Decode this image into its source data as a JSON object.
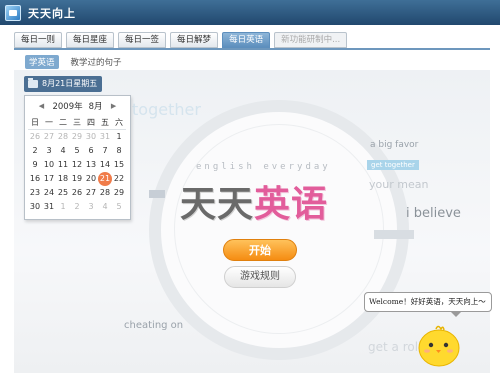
{
  "app": {
    "title": "天天向上",
    "icon": "app-window-icon"
  },
  "tabs": [
    {
      "label": "每日一则",
      "active": false
    },
    {
      "label": "每日星座",
      "active": false
    },
    {
      "label": "每日一签",
      "active": false
    },
    {
      "label": "每日解梦",
      "active": false
    },
    {
      "label": "每日英语",
      "active": true
    },
    {
      "label": "新功能研制中...",
      "active": false,
      "disabled": true
    }
  ],
  "subtabs": [
    {
      "label": "学英语",
      "active": true
    },
    {
      "label": "教学过的句子",
      "active": false
    }
  ],
  "date_chip": {
    "label": "8月21日星期五",
    "icon": "folder-icon"
  },
  "calendar": {
    "year": "2009年",
    "month": "8月",
    "prev": "◀",
    "next": "▶",
    "weekdays": [
      "日",
      "一",
      "二",
      "三",
      "四",
      "五",
      "六"
    ],
    "days": [
      [
        "26",
        "27",
        "28",
        "29",
        "30",
        "31",
        "1"
      ],
      [
        "2",
        "3",
        "4",
        "5",
        "6",
        "7",
        "8"
      ],
      [
        "9",
        "10",
        "11",
        "12",
        "13",
        "14",
        "15"
      ],
      [
        "16",
        "17",
        "18",
        "19",
        "20",
        "21",
        "22"
      ],
      [
        "23",
        "24",
        "25",
        "26",
        "27",
        "28",
        "29"
      ],
      [
        "30",
        "31",
        "1",
        "2",
        "3",
        "4",
        "5"
      ]
    ]
  },
  "logo": {
    "tagline": "english everyday",
    "part1": "天天",
    "part2": "英语",
    "colors": {
      "gray": "#6a6a6a",
      "pink": "#e25d9b"
    }
  },
  "buttons": {
    "start": "开始",
    "rules": "游戏规则"
  },
  "background_words": {
    "big_favor": "a big favor",
    "get_together_tag": "get together",
    "your_mean": "your mean",
    "i_believe": "i believe",
    "cheating_on": "cheating on",
    "get_a_roll": "get a roll"
  },
  "bubble": {
    "text": "Welcome！好好英语，天天向上～"
  },
  "mascot": {
    "icon": "chick-mascot-icon"
  }
}
